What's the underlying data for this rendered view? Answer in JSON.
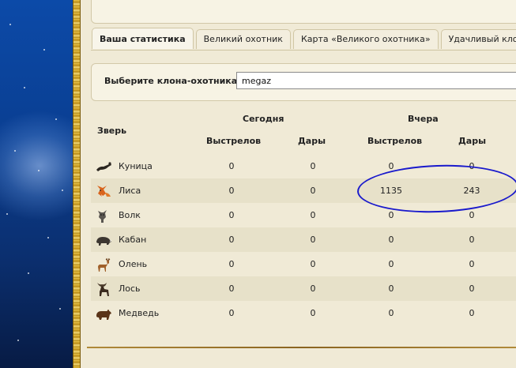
{
  "tabs": [
    {
      "label": "Ваша статистика",
      "active": true
    },
    {
      "label": "Великий охотник",
      "active": false
    },
    {
      "label": "Карта «Великого охотника»",
      "active": false
    },
    {
      "label": "Удачливый клон",
      "active": false
    }
  ],
  "selector": {
    "label": "Выберите клона-охотника:",
    "value": "megaz"
  },
  "table": {
    "animal_header": "Зверь",
    "today_header": "Сегодня",
    "yesterday_header": "Вчера",
    "shots_header": "Выстрелов",
    "gifts_header": "Дары",
    "rows": [
      {
        "animal": "Куница",
        "icon": "marten-icon",
        "today_shots": "0",
        "today_gifts": "0",
        "yesterday_shots": "0",
        "yesterday_gifts": "0"
      },
      {
        "animal": "Лиса",
        "icon": "fox-icon",
        "today_shots": "0",
        "today_gifts": "0",
        "yesterday_shots": "1135",
        "yesterday_gifts": "243"
      },
      {
        "animal": "Волк",
        "icon": "wolf-icon",
        "today_shots": "0",
        "today_gifts": "0",
        "yesterday_shots": "0",
        "yesterday_gifts": "0"
      },
      {
        "animal": "Кабан",
        "icon": "boar-icon",
        "today_shots": "0",
        "today_gifts": "0",
        "yesterday_shots": "0",
        "yesterday_gifts": "0"
      },
      {
        "animal": "Олень",
        "icon": "deer-icon",
        "today_shots": "0",
        "today_gifts": "0",
        "yesterday_shots": "0",
        "yesterday_gifts": "0"
      },
      {
        "animal": "Лось",
        "icon": "moose-icon",
        "today_shots": "0",
        "today_gifts": "0",
        "yesterday_shots": "0",
        "yesterday_gifts": "0"
      },
      {
        "animal": "Медведь",
        "icon": "bear-icon",
        "today_shots": "0",
        "today_gifts": "0",
        "yesterday_shots": "0",
        "yesterday_gifts": "0"
      }
    ]
  },
  "colors": {
    "annotation": "#1a1acc",
    "page_bg": "#f0ead6",
    "alt_row": "#e7e1c9"
  }
}
